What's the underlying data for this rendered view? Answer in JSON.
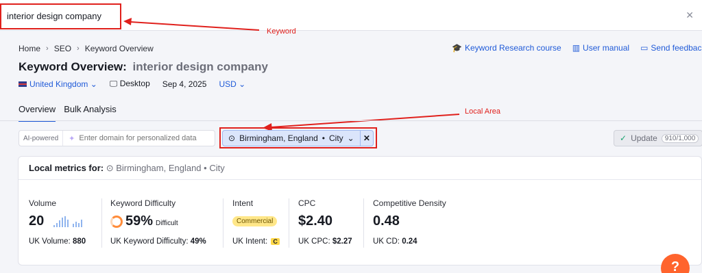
{
  "search": {
    "value": "interior design company",
    "clear_icon": "close-icon"
  },
  "annotations": {
    "keyword": "Keyword",
    "local_area": "Local Area",
    "color": "#e0201c"
  },
  "breadcrumb": [
    "Home",
    "SEO",
    "Keyword Overview"
  ],
  "top_links": [
    {
      "icon": "graduation-cap-icon",
      "label": "Keyword Research course"
    },
    {
      "icon": "book-icon",
      "label": "User manual"
    },
    {
      "icon": "message-icon",
      "label": "Send feedbac"
    }
  ],
  "title": {
    "prefix": "Keyword Overview:",
    "keyword": "interior design company"
  },
  "meta": {
    "country": "United Kingdom",
    "device": "Desktop",
    "date": "Sep 4, 2025",
    "currency": "USD"
  },
  "tabs": [
    {
      "label": "Overview",
      "active": true
    },
    {
      "label": "Bulk Analysis",
      "active": false
    }
  ],
  "ai_box": {
    "tag": "AI-powered",
    "placeholder": "Enter domain for personalized data"
  },
  "location_chip": {
    "label": "Birmingham, England",
    "type": "City"
  },
  "update": {
    "label": "Update",
    "count": "910/1,000"
  },
  "card": {
    "heading": "Local metrics for:",
    "location": "Birmingham, England",
    "type": "City"
  },
  "metrics": {
    "volume": {
      "label": "Volume",
      "value": "20",
      "sub_label": "UK Volume:",
      "sub_value": "880",
      "trend": [
        2,
        4,
        6,
        9,
        10,
        7,
        3,
        5,
        4,
        7
      ]
    },
    "kd": {
      "label": "Keyword Difficulty",
      "value": "59%",
      "level": "Difficult",
      "sub_label": "UK Keyword Difficulty:",
      "sub_value": "49%",
      "percent": 59
    },
    "intent": {
      "label": "Intent",
      "value": "Commercial",
      "sub_label": "UK Intent:",
      "sub_value": "C"
    },
    "cpc": {
      "label": "CPC",
      "value": "$2.40",
      "sub_label": "UK CPC:",
      "sub_value": "$2.27"
    },
    "density": {
      "label": "Competitive Density",
      "value": "0.48",
      "sub_label": "UK CD:",
      "sub_value": "0.24"
    }
  },
  "help": "?"
}
